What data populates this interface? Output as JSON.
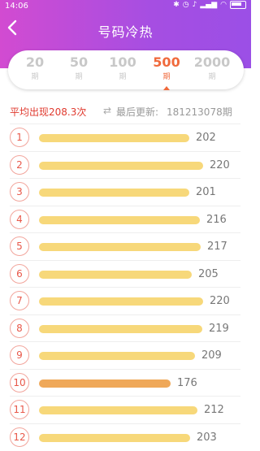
{
  "status_bar": {
    "time": "14:06"
  },
  "header": {
    "back_icon": "chevron-left-icon",
    "title": "号码冷热"
  },
  "period_tabs": [
    {
      "number": "20",
      "unit": "期",
      "active": false
    },
    {
      "number": "50",
      "unit": "期",
      "active": false
    },
    {
      "number": "100",
      "unit": "期",
      "active": false
    },
    {
      "number": "500",
      "unit": "期",
      "active": true
    },
    {
      "number": "2000",
      "unit": "期",
      "active": false
    }
  ],
  "summary": {
    "average_text": "平均出现208.3次",
    "update_label": "最后更新:",
    "update_issue": "181213078期"
  },
  "colors": {
    "header_start": "#d24bd1",
    "header_end": "#9b4fe6",
    "accent": "#f06a3c",
    "bar": "#f7d87a",
    "bar_low": "#efa859"
  },
  "rows": [
    {
      "number": "1",
      "count": "202",
      "value": 202
    },
    {
      "number": "2",
      "count": "220",
      "value": 220
    },
    {
      "number": "3",
      "count": "201",
      "value": 201
    },
    {
      "number": "4",
      "count": "216",
      "value": 216
    },
    {
      "number": "5",
      "count": "217",
      "value": 217
    },
    {
      "number": "6",
      "count": "205",
      "value": 205
    },
    {
      "number": "7",
      "count": "220",
      "value": 220
    },
    {
      "number": "8",
      "count": "219",
      "value": 219
    },
    {
      "number": "9",
      "count": "209",
      "value": 209
    },
    {
      "number": "10",
      "count": "176",
      "value": 176,
      "low": true
    },
    {
      "number": "11",
      "count": "212",
      "value": 212
    },
    {
      "number": "12",
      "count": "203",
      "value": 203
    }
  ]
}
